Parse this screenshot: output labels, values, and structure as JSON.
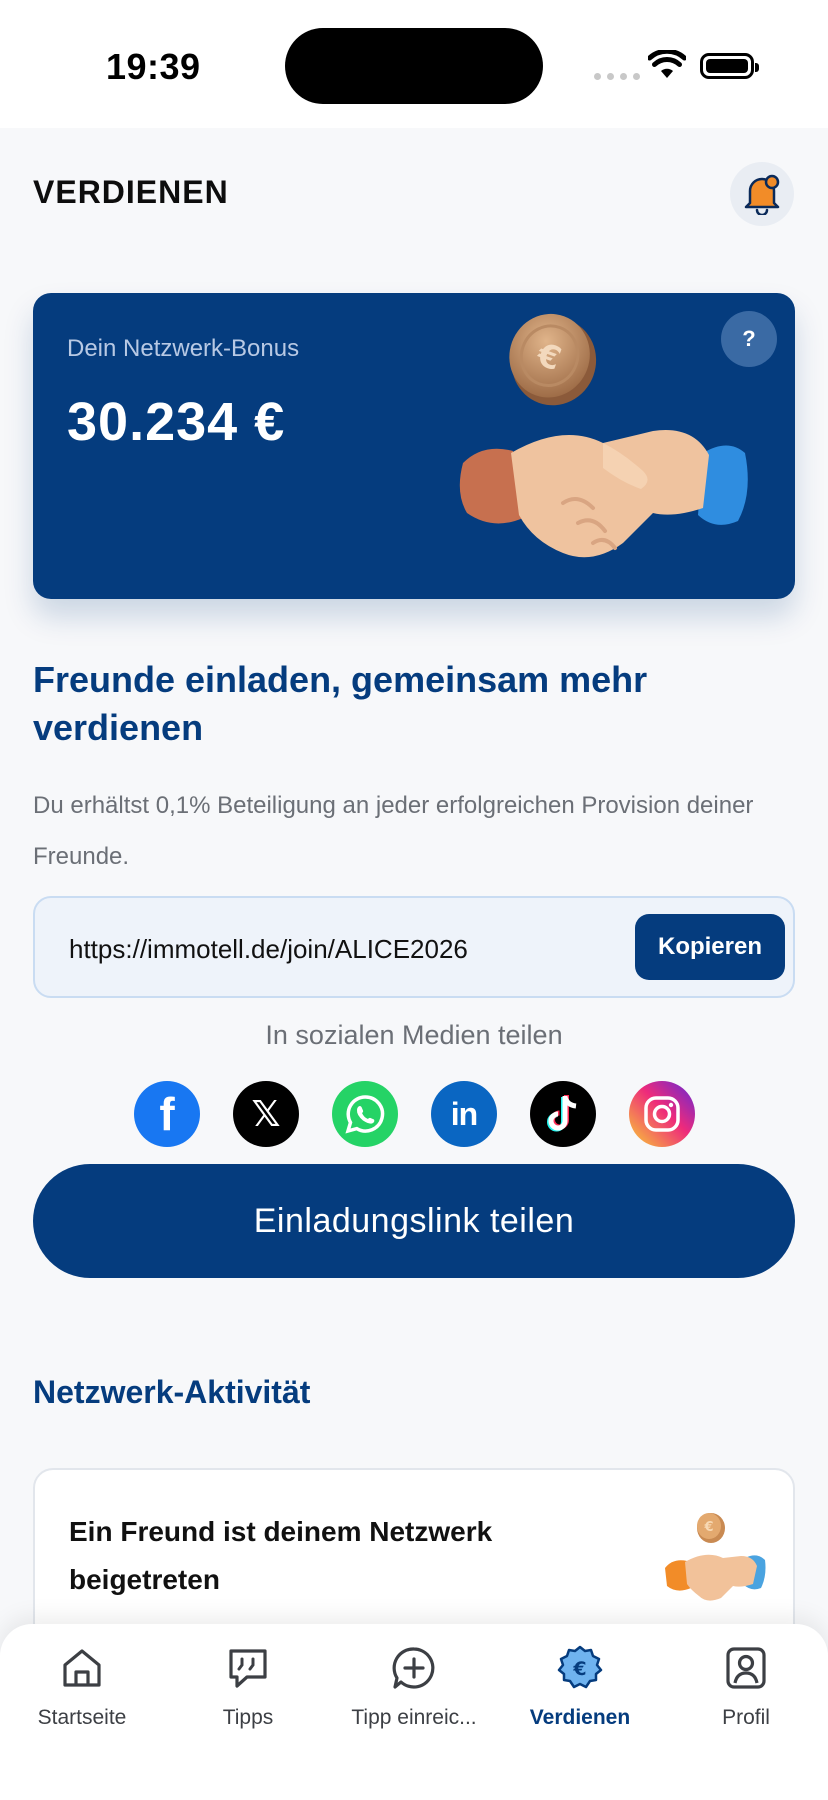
{
  "status_bar": {
    "time": "19:39"
  },
  "header": {
    "title": "VERDIENEN"
  },
  "bonus_card": {
    "label": "Dein Netzwerk-Bonus",
    "amount": "30.234 €",
    "help_label": "?"
  },
  "invite": {
    "heading": "Freunde einladen, gemeinsam mehr verdienen",
    "description": "Du erhältst 0,1% Beteiligung an jeder erfolgreichen Provision deiner Freunde.",
    "link": "https://immotell.de/join/ALICE2026",
    "copy_label": "Kopieren",
    "share_label": "In sozialen Medien teilen",
    "social": [
      {
        "name": "facebook",
        "glyph": "f"
      },
      {
        "name": "x",
        "glyph": "𝕏"
      },
      {
        "name": "whatsapp",
        "glyph": ""
      },
      {
        "name": "linkedin",
        "glyph": "in"
      },
      {
        "name": "tiktok",
        "glyph": ""
      },
      {
        "name": "instagram",
        "glyph": ""
      }
    ],
    "share_button": "Einladungslink teilen"
  },
  "activity": {
    "heading": "Netzwerk-Aktivität",
    "items": [
      {
        "title": "Ein Freund ist deinem Netzwerk beigetreten"
      }
    ]
  },
  "tabbar": {
    "items": [
      {
        "label": "Startseite",
        "icon": "home-icon",
        "active": false
      },
      {
        "label": "Tipps",
        "icon": "quote-bubble-icon",
        "active": false
      },
      {
        "label": "Tipp einreic...",
        "icon": "add-bubble-icon",
        "active": false
      },
      {
        "label": "Verdienen",
        "icon": "euro-icon",
        "active": true
      },
      {
        "label": "Profil",
        "icon": "profile-icon",
        "active": false
      }
    ]
  },
  "colors": {
    "primary": "#053c7e",
    "accent_orange": "#f28c28",
    "background": "#f7f8fa"
  }
}
